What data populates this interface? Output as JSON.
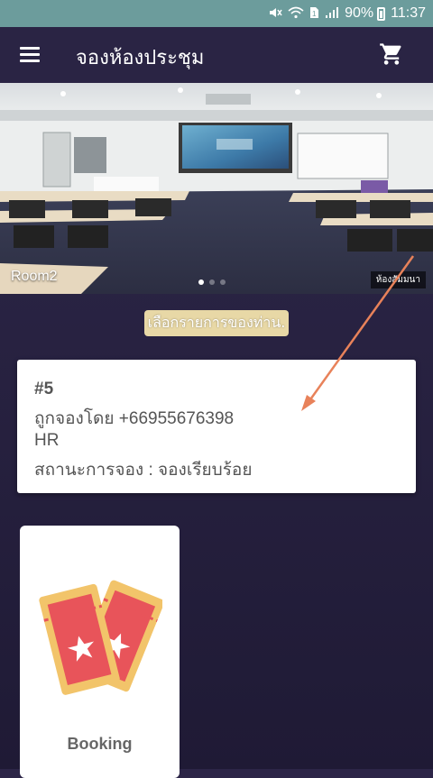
{
  "status_bar": {
    "battery": "90%",
    "time": "11:37",
    "icons": [
      "mute-icon",
      "wifi-icon",
      "sim-icon",
      "signal-icon",
      "battery-icon"
    ]
  },
  "app_bar": {
    "title": "จองห้องประชุม",
    "menu_icon": "menu-icon",
    "cart_icon": "cart-icon"
  },
  "banner": {
    "room_label": "Room2",
    "sign_text": "ห้องสัมมนา",
    "page_count": 3,
    "active_page": 1
  },
  "subtitle": "เลือกรายการของท่าน.",
  "booking_card": {
    "number": "#5",
    "booked_by": "ถูกจองโดย +66955676398",
    "department": "HR",
    "status": "สถานะการจอง : จองเรียบร้อย"
  },
  "tiles": [
    {
      "label": "Booking",
      "icon": "ticket-icon"
    }
  ],
  "colors": {
    "status_bar": "#6c9c9c",
    "app_bar": "#2a2444",
    "background": "#2a2444",
    "subtitle_bg": "#e8d8a6",
    "ticket_red": "#e8545a",
    "ticket_gold": "#f2c46a",
    "annotation_arrow": "#e8825a"
  }
}
